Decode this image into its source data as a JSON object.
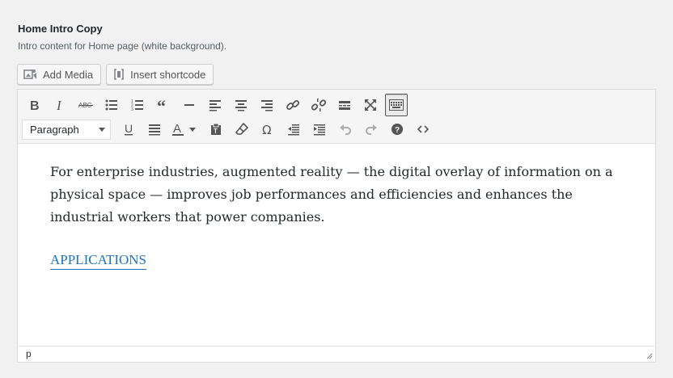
{
  "field": {
    "title": "Home Intro Copy",
    "description": "Intro content for Home page (white background)."
  },
  "media_buttons": {
    "add_media": "Add Media",
    "insert_shortcode": "Insert shortcode"
  },
  "toolbar": {
    "format_select": "Paragraph",
    "row1_icons": [
      "bold-icon",
      "italic-icon",
      "strikethrough-icon",
      "bulleted-list-icon",
      "numbered-list-icon",
      "blockquote-icon",
      "horizontal-line-icon",
      "align-left-icon",
      "align-center-icon",
      "align-right-icon",
      "insert-link-icon",
      "remove-link-icon",
      "read-more-icon",
      "fullscreen-icon",
      "toolbar-toggle-icon"
    ],
    "row2_icons": [
      "underline-icon",
      "justify-icon",
      "text-color-icon",
      "paste-as-text-icon",
      "clear-formatting-icon",
      "special-character-icon",
      "outdent-icon",
      "indent-icon",
      "undo-icon",
      "redo-icon",
      "help-icon",
      "code-icon"
    ]
  },
  "content": {
    "paragraph": "For enterprise industries, augmented reality — the digital overlay of information on a physical space — improves job performances and efficiencies and enhances the industrial workers that power companies.",
    "link": "APPLICATIONS"
  },
  "statusbar": {
    "path": "p"
  },
  "colors": {
    "background": "#f1f1f1",
    "link": "#1e73be",
    "icon": "#555555"
  }
}
